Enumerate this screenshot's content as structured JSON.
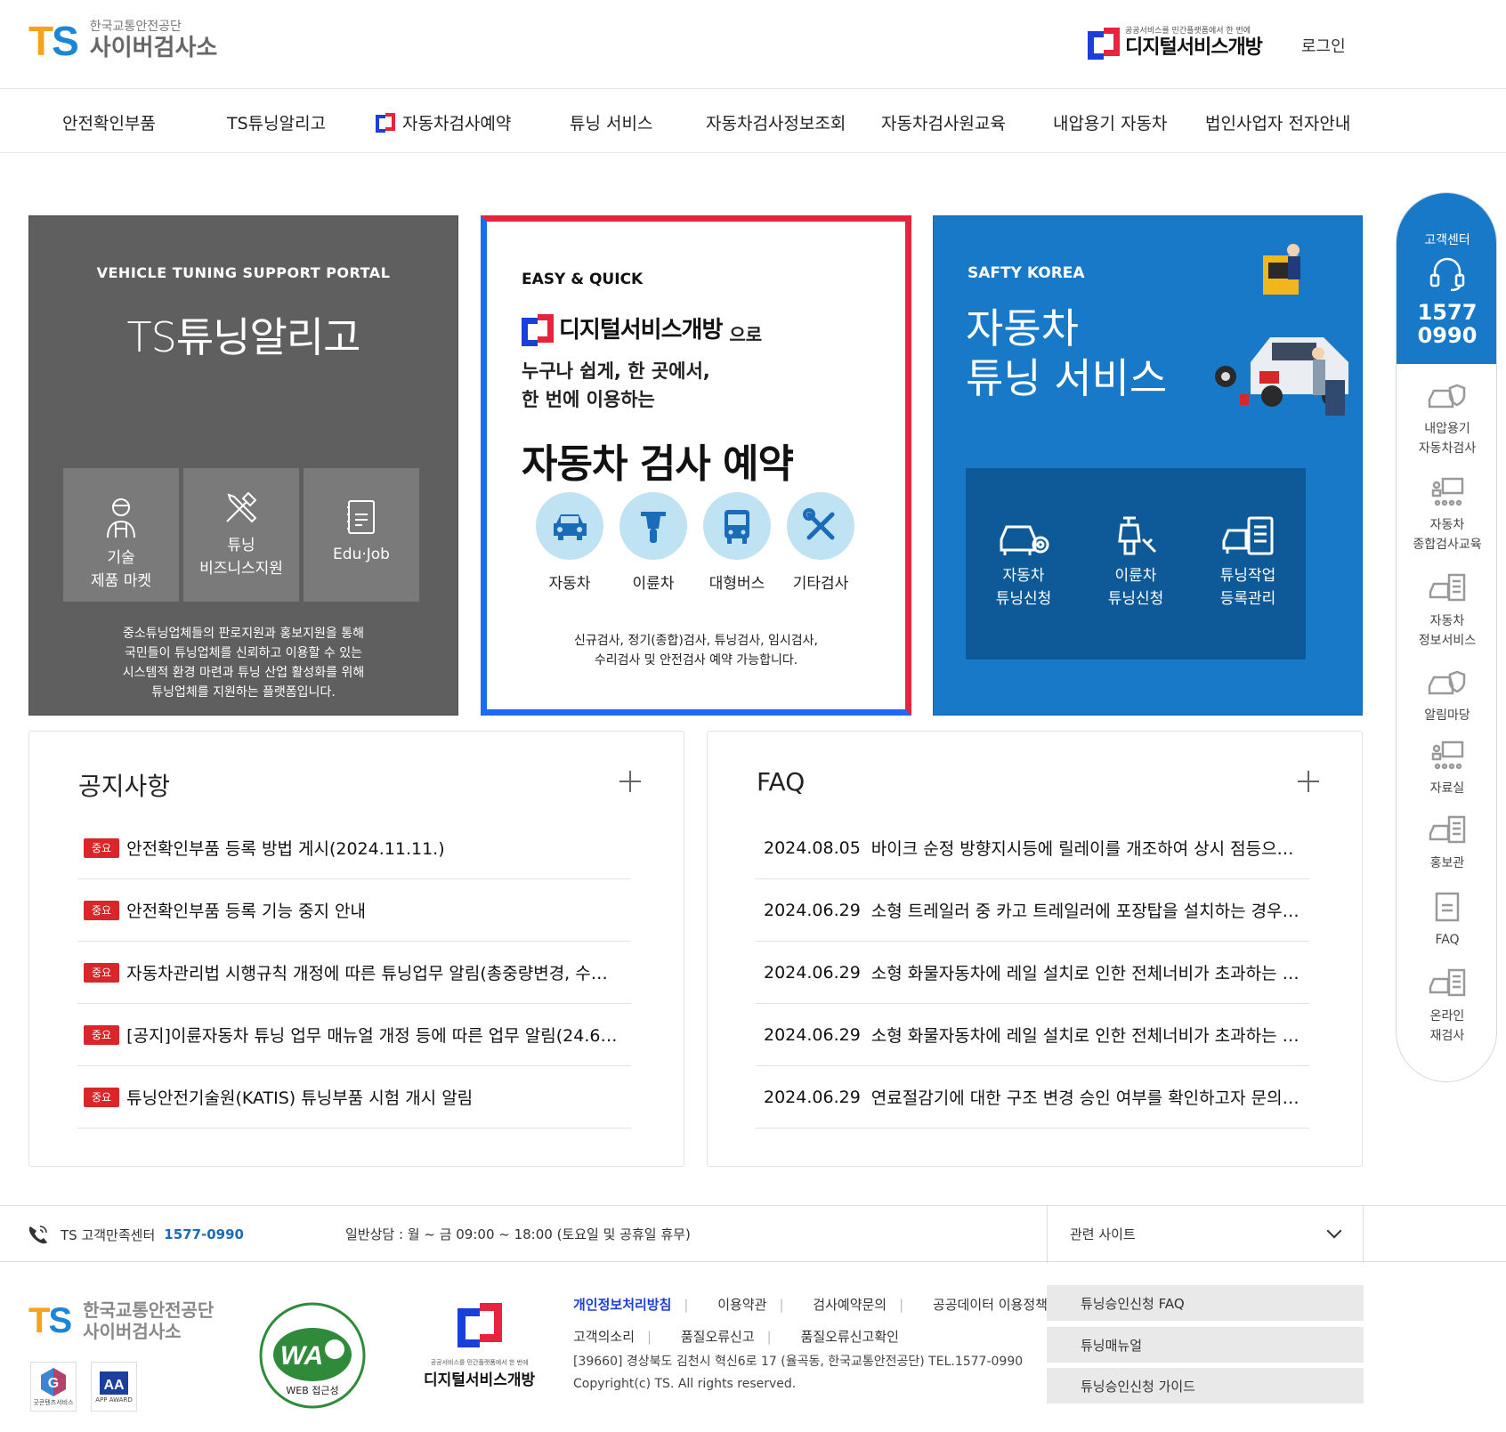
{
  "header": {
    "logo_mark_t": "T",
    "logo_mark_s": "S",
    "logo_sub": "한국교통안전공단",
    "logo_main": "사이버검사소",
    "ds_small": "공공서비스를 민간플랫폼에서 한 번에",
    "ds_big": "디지털서비스개방",
    "login": "로그인"
  },
  "nav": {
    "items": [
      "안전확인부품",
      "TS튜닝알리고",
      "자동차검사예약",
      "튜닝 서비스",
      "자동차검사정보조회",
      "자동차검사원교육",
      "내압용기 자동차",
      "법인사업자 전자안내"
    ]
  },
  "card1": {
    "kicker": "VEHICLE TUNING SUPPORT PORTAL",
    "title": "TS튜닝알리고",
    "tiles": [
      {
        "line1": "기술",
        "line2": "제품 마켓",
        "icon": "mechanic-icon"
      },
      {
        "line1": "튜닝",
        "line2": "비즈니스지원",
        "icon": "tools-icon"
      },
      {
        "line1": "Edu·Job",
        "line2": "",
        "icon": "document-icon"
      }
    ],
    "desc": [
      "중소튜닝업체들의 판로지원과 홍보지원을 통해",
      "국민들이 튜닝업체를 신뢰하고 이용할 수 있는",
      "시스템적 환경 마련과 튜닝 산업 활성화를 위해",
      "튜닝업체를 지원하는 플랫폼입니다."
    ]
  },
  "card2": {
    "kicker": "EASY & QUICK",
    "brand": "디지털서비스개방",
    "brand_suffix": "으로",
    "sub1": "누구나 쉽게, 한 곳에서,",
    "sub2": "한 번에 이용하는",
    "title": "자동차 검사 예약",
    "circles": [
      {
        "label": "자동차",
        "icon": "car-icon"
      },
      {
        "label": "이륜차",
        "icon": "motorcycle-icon"
      },
      {
        "label": "대형버스",
        "icon": "bus-icon"
      },
      {
        "label": "기타검사",
        "icon": "wrench-screwdriver-icon"
      }
    ],
    "desc1": "신규검사, 정기(종합)검사, 튜닝검사, 임시검사,",
    "desc2": "수리검사 및 안전검사 예약 가능합니다."
  },
  "card3": {
    "kicker": "SAFTY KOREA",
    "title1": "자동차",
    "title2": "튜닝 서비스",
    "tiles": [
      {
        "line1": "자동차",
        "line2": "튜닝신청",
        "icon": "car-gear-icon"
      },
      {
        "line1": "이륜차",
        "line2": "튜닝신청",
        "icon": "scooter-wrench-icon"
      },
      {
        "line1": "튜닝작업",
        "line2": "등록관리",
        "icon": "car-checklist-icon"
      }
    ]
  },
  "quick": {
    "title": "고객센터",
    "num1": "1577",
    "num2": "0990",
    "items": [
      {
        "label": [
          "내압용기",
          "자동차검사"
        ],
        "icon": "car-shield-icon"
      },
      {
        "label": [
          "자동차",
          "종합검사교육"
        ],
        "icon": "classroom-icon"
      },
      {
        "label": [
          "자동차",
          "정보서비스"
        ],
        "icon": "car-checklist-icon"
      },
      {
        "label": [
          "알림마당"
        ],
        "icon": "car-shield-icon"
      },
      {
        "label": [
          "자료실"
        ],
        "icon": "classroom-icon"
      },
      {
        "label": [
          "홍보관"
        ],
        "icon": "car-checklist-icon"
      },
      {
        "label": [
          "FAQ"
        ],
        "icon": "document-icon"
      },
      {
        "label": [
          "온라인",
          "재검사"
        ],
        "icon": "car-checklist-icon"
      }
    ]
  },
  "notice": {
    "title": "공지사항",
    "badge": "중요",
    "items": [
      "안전확인부품 등록 방법 게시(2024.11.11.)",
      "안전확인부품 등록 기능 중지 안내",
      "자동차관리법 시행규칙 개정에 따른 튜닝업무 알림(총중량변경, 수…",
      "[공지]이륜자동차 튜닝 업무 매뉴얼 개정 등에 따른 업무 알림(24.6…",
      "튜닝안전기술원(KATIS) 튜닝부품 시험 개시 알림"
    ]
  },
  "faq": {
    "title": "FAQ",
    "items": [
      {
        "date": "2024.08.05",
        "text": "바이크 순정 방향지시등에 릴레이를 개조하여 상시 점등으…"
      },
      {
        "date": "2024.06.29",
        "text": "소형 트레일러 중 카고 트레일러에 포장탑을 설치하는 경우…"
      },
      {
        "date": "2024.06.29",
        "text": "소형 화물자동차에 레일 설치로 인한 전체너비가 초과하는 …"
      },
      {
        "date": "2024.06.29",
        "text": "소형 화물자동차에 레일 설치로 인한 전체너비가 초과하는 …"
      },
      {
        "date": "2024.06.29",
        "text": "연료절감기에 대한 구조 변경 승인 여부를 확인하고자 문의…"
      }
    ]
  },
  "cs_bar": {
    "label": "TS 고객만족센터",
    "number": "1577-0990",
    "hours": "일반상담 : 월 ~ 금 09:00 ~ 18:00 (토요일 및 공휴일 휴무)",
    "related": "관련 사이트"
  },
  "footer": {
    "org1": "한국교통안전공단",
    "org2": "사이버검사소",
    "badge1": "굿콘텐츠서비스",
    "badge2": "APP AWARD",
    "wa_text": "WA",
    "wa_caption": "WEB 접근성",
    "ds_small": "공공서비스를 민간플랫폼에서 한 번에",
    "ds_big": "디지털서비스개방",
    "links_row1": [
      "개인정보처리방침",
      "이용약관",
      "검사예약문의",
      "공공데이터 이용정책"
    ],
    "links_row2": [
      "고객의소리",
      "품질오류신고",
      "품질오류신고확인"
    ],
    "address": "[39660] 경상북도 김천시 혁신6로 17 (율곡동, 한국교통안전공단) TEL.1577-0990",
    "copyright": "Copyright(c) TS. All rights reserved.",
    "buttons": [
      "튜닝승인신청 FAQ",
      "튜닝매뉴얼",
      "튜닝승인신청 가이드"
    ]
  },
  "colors": {
    "brand_orange": "#f7a21b",
    "brand_blue": "#1b86d6",
    "ds_blue": "#1b3fd8",
    "ds_red": "#e6243e",
    "panel_blue": "#1779c8",
    "badge_red": "#d8262a"
  }
}
